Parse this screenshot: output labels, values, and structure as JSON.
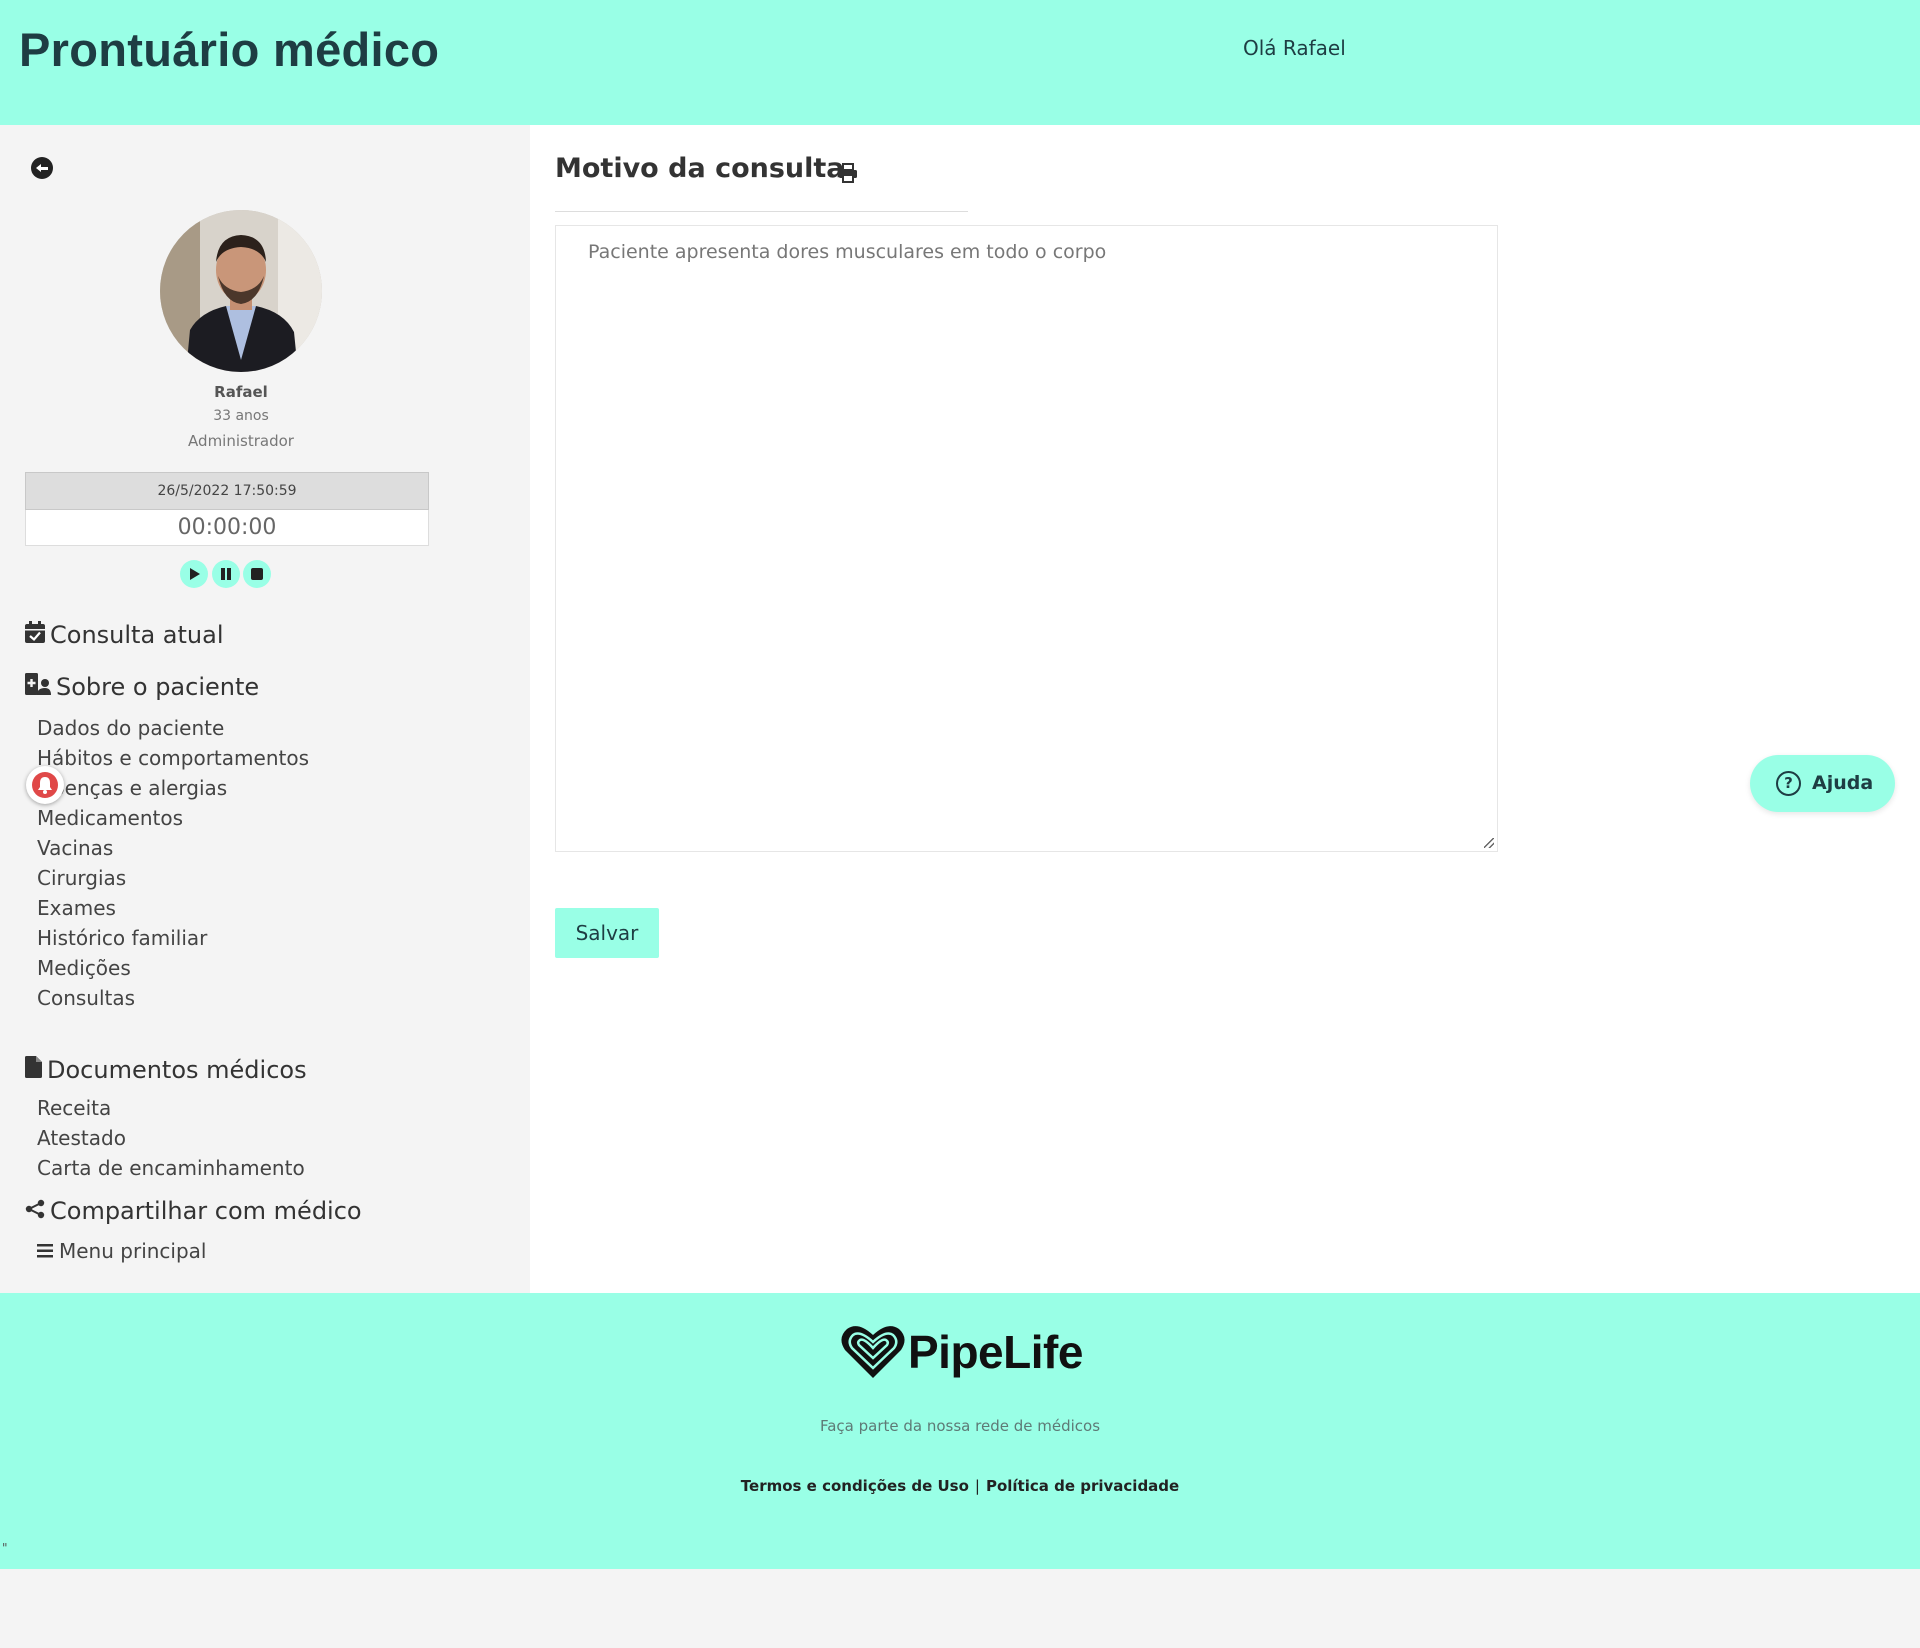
{
  "header": {
    "title": "Prontuário médico",
    "greeting": "Olá Rafael"
  },
  "patient": {
    "name": "Rafael",
    "age": "33 anos",
    "role": "Administrador"
  },
  "timer": {
    "datetime": "26/5/2022 17:50:59",
    "elapsed": "00:00:00"
  },
  "sidebar": {
    "current_consult": "Consulta atual",
    "about_patient": {
      "title": "Sobre o paciente",
      "items": [
        "Dados do paciente",
        "Hábitos e comportamentos",
        "Doenças e alergias",
        "Medicamentos",
        "Vacinas",
        "Cirurgias",
        "Exames",
        "Histórico familiar",
        "Medições",
        "Consultas"
      ]
    },
    "documents": {
      "title": "Documentos médicos",
      "items": [
        "Receita",
        "Atestado",
        "Carta de encaminhamento"
      ]
    },
    "share": "Compartilhar com médico",
    "main_menu": "Menu principal"
  },
  "main": {
    "title": "Motivo da consulta",
    "reason_text": "Paciente apresenta dores musculares em todo o corpo",
    "save_label": "Salvar"
  },
  "help": {
    "label": "Ajuda",
    "glyph": "?"
  },
  "footer": {
    "brand": "PipeLife",
    "tagline": "Faça parte da nossa rede de médicos",
    "terms": "Termos e condições de Uso",
    "separator": "|",
    "privacy": "Política de privacidade",
    "stray_mark": "\""
  },
  "colors": {
    "accent": "#99ffe6",
    "sidebar_bg": "#f4f4f4",
    "text_dark": "#1e3d43",
    "notification": "#e04848"
  }
}
